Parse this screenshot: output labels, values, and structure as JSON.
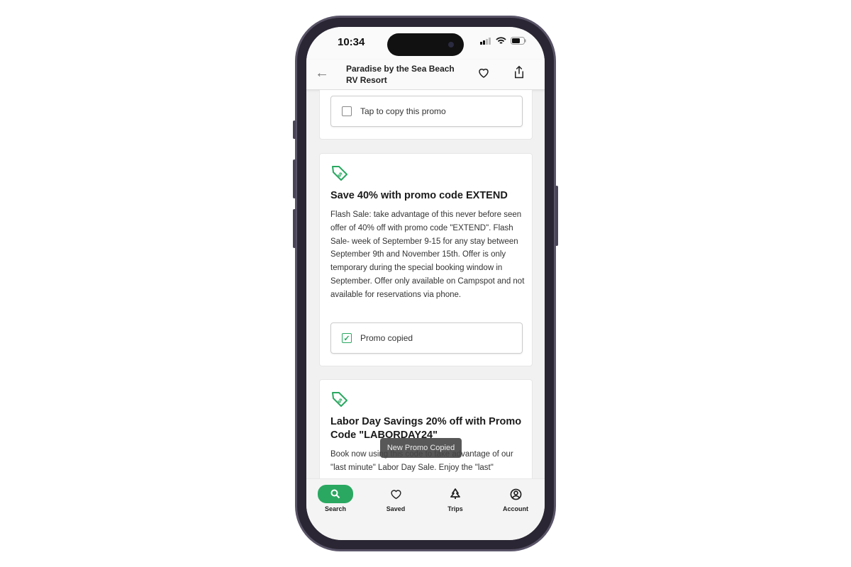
{
  "status": {
    "time": "10:34"
  },
  "header": {
    "title": "Paradise by the Sea Beach RV Resort"
  },
  "promos": [
    {
      "copy_label": "Tap to copy this promo",
      "copied": false
    },
    {
      "title": "Save 40% with promo code EXTEND",
      "description": "Flash Sale: take advantage of this never before seen offer of 40% off with promo code \"EXTEND\".  Flash Sale- week of September 9-15 for any stay between September 9th and November 15th.  Offer is only temporary during the special booking window in September.  Offer only available on Campspot and not available for reservations via phone.",
      "copy_label": "Promo copied",
      "copied": true
    },
    {
      "title": "Labor Day Savings 20% off with Promo Code \"LABORDAY24\"",
      "description": "Book now using this code to take advantage of our \"last minute\" Labor Day Sale.  Enjoy the \"last\""
    }
  ],
  "toast": "New Promo Copied",
  "nav": [
    {
      "label": "Search",
      "active": true
    },
    {
      "label": "Saved"
    },
    {
      "label": "Trips"
    },
    {
      "label": "Account"
    }
  ],
  "colors": {
    "accent": "#2aa861"
  }
}
